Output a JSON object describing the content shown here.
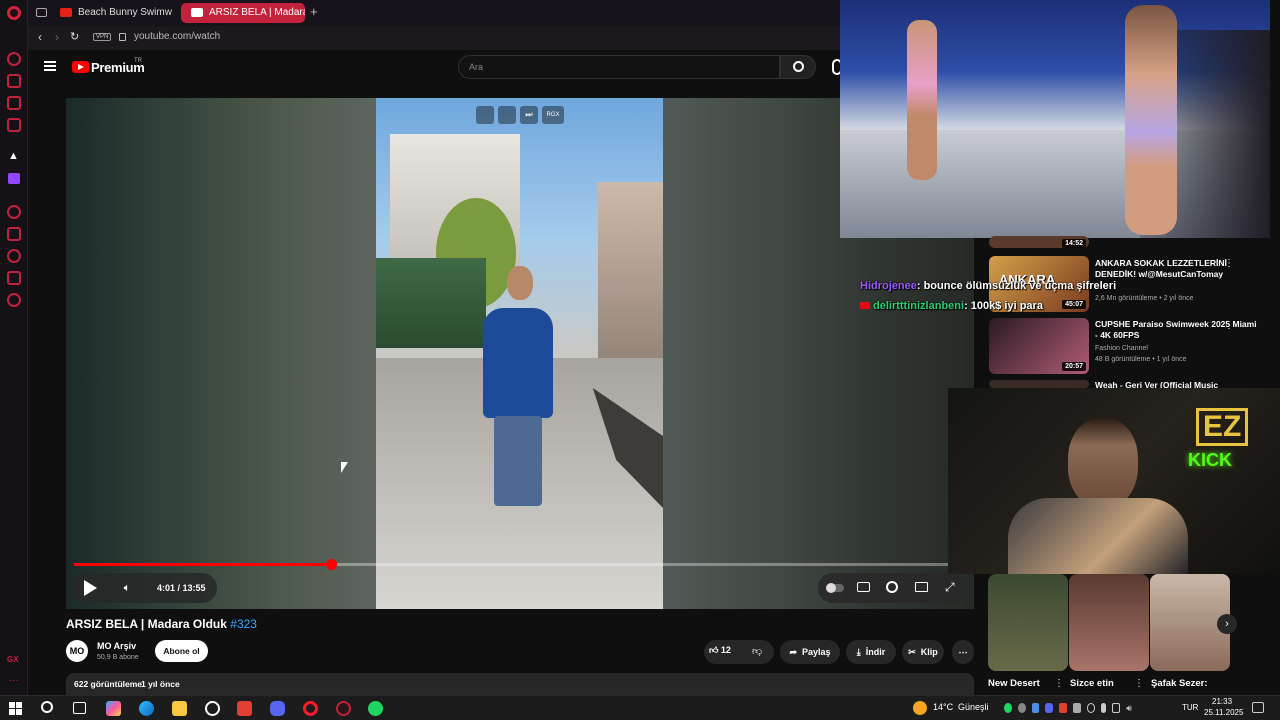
{
  "browser": {
    "tabs": [
      {
        "label": "Beach Bunny Swimwear F"
      },
      {
        "label": "ARSIZ BELA | Madara"
      }
    ],
    "new_tab": "+",
    "vpn_badge": "VPN",
    "url": "youtube.com/watch"
  },
  "youtube": {
    "logo_text": "Premium",
    "logo_sup": "TR",
    "search_placeholder": "Ara"
  },
  "player": {
    "time_current": "4:01",
    "time_total": "13:55",
    "time_separator": " / ",
    "progress_fraction": 0.2886,
    "overlay_badge": "RGX"
  },
  "video": {
    "title": "ARSIZ BELA | Madara Olduk",
    "hashtag": "#323",
    "channel_avatar": "MO",
    "channel_name": "MO Arşiv",
    "subscribers": "50,9 B abone",
    "subscribe_label": "Abone ol",
    "likes": "12",
    "share_label": "Paylaş",
    "download_label": "İndir",
    "clip_label": "Klip",
    "views": "622 görüntüleme",
    "published": "1 yıl önce"
  },
  "recommendations": [
    {
      "title": "",
      "duration": "14:52",
      "channel": "",
      "meta": ""
    },
    {
      "title": "ANKARA SOKAK LEZZETLERİNİ DENEDİK! w/@MesutCanTomay",
      "duration": "45:07",
      "channel": "",
      "meta": "2,6 Mn görüntüleme • 2 yıl önce",
      "thumb_text": "ANKARA"
    },
    {
      "title": "CUPSHE Paraiso Swimweek 2025 Miami - 4K 60FPS",
      "duration": "20:57",
      "channel": "Fashion Channel",
      "meta": "48 B görüntüleme • 1 yıl önce"
    },
    {
      "title": "Weah - Geri Ver (Official Music",
      "duration": "",
      "channel": "",
      "meta": ""
    }
  ],
  "chat": [
    {
      "user": "Hidrojenee",
      "message": ": bounce ölümsüzlük ve uçma şifreleri",
      "user_color": "#9b59ff"
    },
    {
      "user": "delirtttinizlanbeni",
      "message": ": 100k$ iyi para",
      "user_color": "#2ecc71"
    }
  ],
  "webcam": {
    "logo_top": "EZ",
    "logo_bottom": "KICK"
  },
  "shorts": [
    {
      "title": "New Desert"
    },
    {
      "title": "Sizce etin"
    },
    {
      "title": "Şafak Sezer:"
    }
  ],
  "taskbar": {
    "weather": "14°C",
    "weather_label": "Güneşli",
    "language": "TUR",
    "time": "21:33",
    "date": "25.11.2025"
  },
  "colors": {
    "accent": "#ff0000",
    "opera_red": "#c2223b",
    "active_tab": "#c2223b",
    "kick_green": "#53fc18"
  }
}
